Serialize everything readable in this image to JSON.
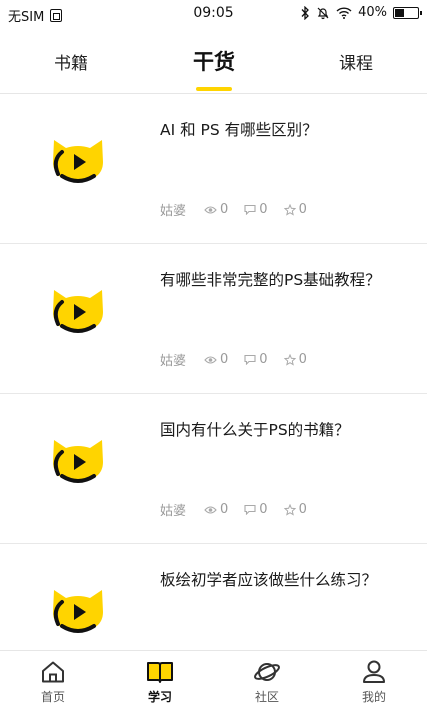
{
  "status_bar": {
    "carrier": "无SIM",
    "time": "09:05",
    "battery_text": "40%",
    "battery_level": 0.4
  },
  "top_tabs": {
    "items": [
      {
        "label": "书籍",
        "active": false
      },
      {
        "label": "干货",
        "active": true
      },
      {
        "label": "课程",
        "active": false
      }
    ],
    "accent_color": "#FFD400"
  },
  "feed": {
    "items": [
      {
        "title": "AI 和 PS 有哪些区别？",
        "author": "姑婆",
        "views": "0",
        "comments": "0",
        "favorites": "0",
        "thumb_icon": "cat-play-icon"
      },
      {
        "title": "有哪些非常完整的PS基础教程？",
        "author": "姑婆",
        "views": "0",
        "comments": "0",
        "favorites": "0",
        "thumb_icon": "cat-play-icon"
      },
      {
        "title": "国内有什么关于PS的书籍？",
        "author": "姑婆",
        "views": "0",
        "comments": "0",
        "favorites": "0",
        "thumb_icon": "cat-play-icon"
      },
      {
        "title": "板绘初学者应该做些什么练习？",
        "author": "",
        "views": "",
        "comments": "",
        "favorites": "",
        "thumb_icon": "cat-play-icon"
      }
    ]
  },
  "bottom_nav": {
    "items": [
      {
        "label": "首页",
        "icon": "home-icon",
        "active": false
      },
      {
        "label": "学习",
        "icon": "book-icon",
        "active": true
      },
      {
        "label": "社区",
        "icon": "planet-icon",
        "active": false
      },
      {
        "label": "我的",
        "icon": "profile-icon",
        "active": false
      }
    ]
  },
  "colors": {
    "brand_yellow": "#FFD400",
    "text_dark": "#1a1a1a",
    "text_meta": "#9a9a9a"
  }
}
